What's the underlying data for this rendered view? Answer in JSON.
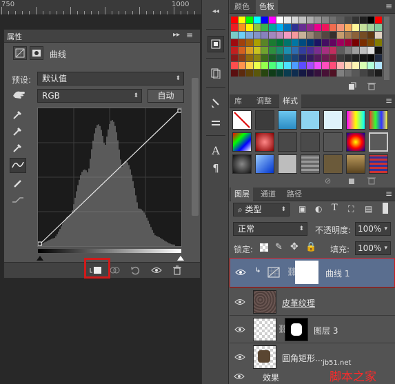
{
  "ruler": {
    "labels": [
      "750",
      "1000"
    ]
  },
  "properties": {
    "tab_label": "属性",
    "collapse_label": "▸▸",
    "layer_type": "曲线",
    "preset_label": "预设:",
    "preset_value": "默认值",
    "channel_value": "RGB",
    "auto_button": "自动"
  },
  "colors_panel": {
    "tabs": [
      "颜色",
      "色板"
    ]
  },
  "styles_panel": {
    "tabs": [
      "库",
      "调整",
      "样式"
    ]
  },
  "layers_panel": {
    "tabs": [
      "图层",
      "通道",
      "路径"
    ],
    "filter_kind": "类型",
    "blend_mode": "正常",
    "opacity_label": "不透明度:",
    "opacity_value": "100%",
    "lock_label": "锁定:",
    "fill_label": "填充:",
    "fill_value": "100%",
    "layers": [
      {
        "name": "曲线 1",
        "type": "adjustment"
      },
      {
        "name": "皮革纹理",
        "type": "raster"
      },
      {
        "name": "图层 3",
        "type": "masked"
      },
      {
        "name": "圆角矩形...",
        "type": "shape"
      }
    ],
    "effects_label": "效果"
  },
  "watermark": {
    "site": "jb51.net",
    "name": "脚本之家"
  },
  "accent_colors": {
    "highlight_red": "#d11a1a",
    "selected_layer": "#5a6e8f"
  }
}
